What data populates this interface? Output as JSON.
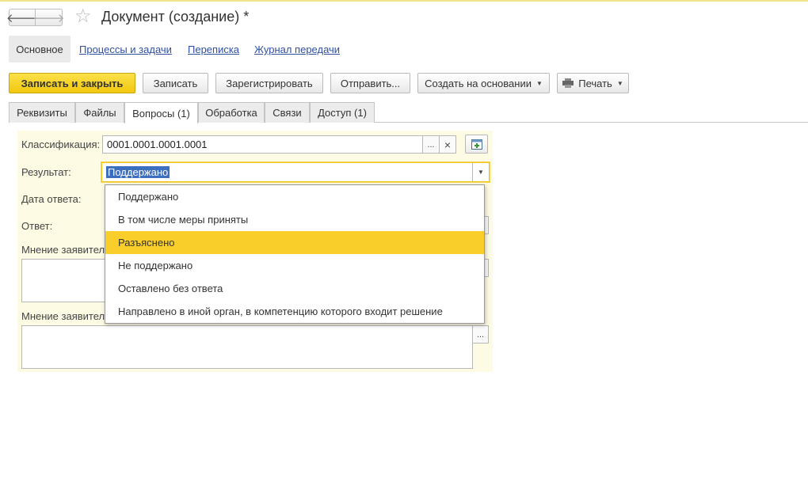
{
  "window": {
    "title": "Документ (создание) *",
    "back_glyph": "🡐",
    "forward_glyph": "🡒",
    "star_glyph": "☆"
  },
  "sections": {
    "active": "Основное",
    "links": [
      "Процессы и задачи",
      "Переписка",
      "Журнал передачи"
    ]
  },
  "toolbar": {
    "save_close": "Записать и закрыть",
    "save": "Записать",
    "register": "Зарегистрировать",
    "send": "Отправить...",
    "create_based": "Создать на основании",
    "print": "Печать"
  },
  "tabs": [
    "Реквизиты",
    "Файлы",
    "Вопросы (1)",
    "Обработка",
    "Связи",
    "Доступ (1)"
  ],
  "form": {
    "classification_label": "Классификация:",
    "classification_value": "0001.0001.0001.0001",
    "result_label": "Результат:",
    "result_value": "Поддержано",
    "answer_date_label": "Дата ответа:",
    "answer_label": "Ответ:",
    "opinion1_label": "Мнение заявител",
    "opinion2_label": "Мнение заявител",
    "ellipsis": "...",
    "clear": "×"
  },
  "dropdown": {
    "options": [
      "Поддержано",
      "В том числе меры приняты",
      "Разъяснено",
      "Не поддержано",
      "Оставлено без ответа",
      "Направлено в иной орган, в компетенцию которого входит решение"
    ],
    "highlighted_index": 2
  },
  "colors": {
    "primary_button": "#f5cd1a",
    "highlight": "#f9cd2a",
    "link": "#3050a0",
    "form_bg": "#fdfbe4"
  }
}
